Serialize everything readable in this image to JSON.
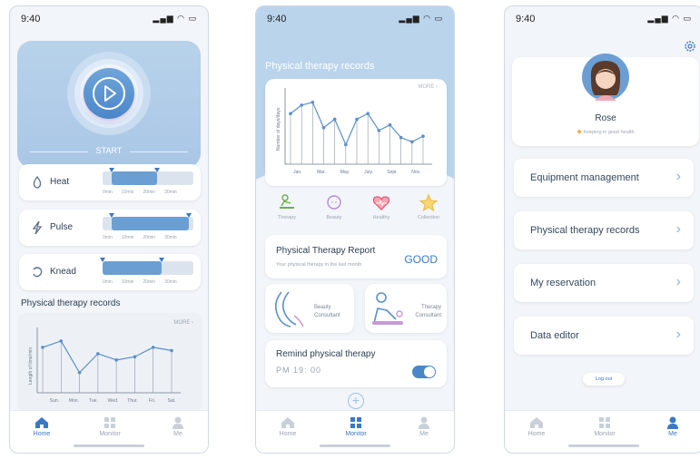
{
  "status": {
    "time": "9:40"
  },
  "screen1": {
    "start_label": "START",
    "modes": [
      {
        "label": "Heat",
        "icon": "flame-icon",
        "fill_from": 0.1,
        "fill_to": 0.6
      },
      {
        "label": "Pulse",
        "icon": "lightning-icon",
        "fill_from": 0.1,
        "fill_to": 0.95
      },
      {
        "label": "Knead",
        "icon": "knead-icon",
        "fill_from": 0.0,
        "fill_to": 0.65
      }
    ],
    "ticks": [
      "0min",
      "10min",
      "20min",
      "30min"
    ],
    "records_title": "Physical therapy records",
    "more": "MORE",
    "chart_data": {
      "type": "line",
      "categories": [
        "Sun.",
        "Mon.",
        "Tue.",
        "Wed.",
        "Thur.",
        "Fri.",
        "Sat."
      ],
      "values": [
        58,
        64,
        34,
        52,
        46,
        49,
        58,
        55
      ],
      "ylabel": "Length of time/min"
    }
  },
  "screen2": {
    "header_title": "Physical therapy records",
    "more": "MORE",
    "chart_data": {
      "type": "line",
      "categories": [
        "Jan.",
        "Mar.",
        "May.",
        "July.",
        "Sept.",
        "Nov."
      ],
      "values": [
        62,
        68,
        70,
        52,
        58,
        40,
        58,
        62,
        50,
        54,
        45,
        42,
        46
      ],
      "ylabel": "Number of days/days"
    },
    "categories": [
      {
        "label": "Therapy",
        "icon": "therapy-icon"
      },
      {
        "label": "Beauty",
        "icon": "beauty-icon"
      },
      {
        "label": "Healthy",
        "icon": "healthy-icon"
      },
      {
        "label": "Collection",
        "icon": "star-icon"
      }
    ],
    "report": {
      "title": "Physical Therapy Report",
      "subtitle": "Your physical therapy in the last month",
      "status": "GOOD"
    },
    "consultants": [
      {
        "label_line1": "Beauty",
        "label_line2": "Consultant"
      },
      {
        "label_line1": "Therapy",
        "label_line2": "Consultant"
      }
    ],
    "remind": {
      "title": "Remind physical therapy",
      "time": "PM 19: 00",
      "on": true
    }
  },
  "screen3": {
    "profile": {
      "name": "Rose",
      "motto": "Keeping in good health"
    },
    "menu": [
      "Equipment management",
      "Physical therapy records",
      "My reservation",
      "Data editor"
    ],
    "logout": "Log out"
  },
  "tabs": [
    "Home",
    "Monitor",
    "Me"
  ],
  "colors": {
    "accent": "#3a78c4",
    "light_blue": "#b9d3ec",
    "bg": "#f2f5f9"
  }
}
